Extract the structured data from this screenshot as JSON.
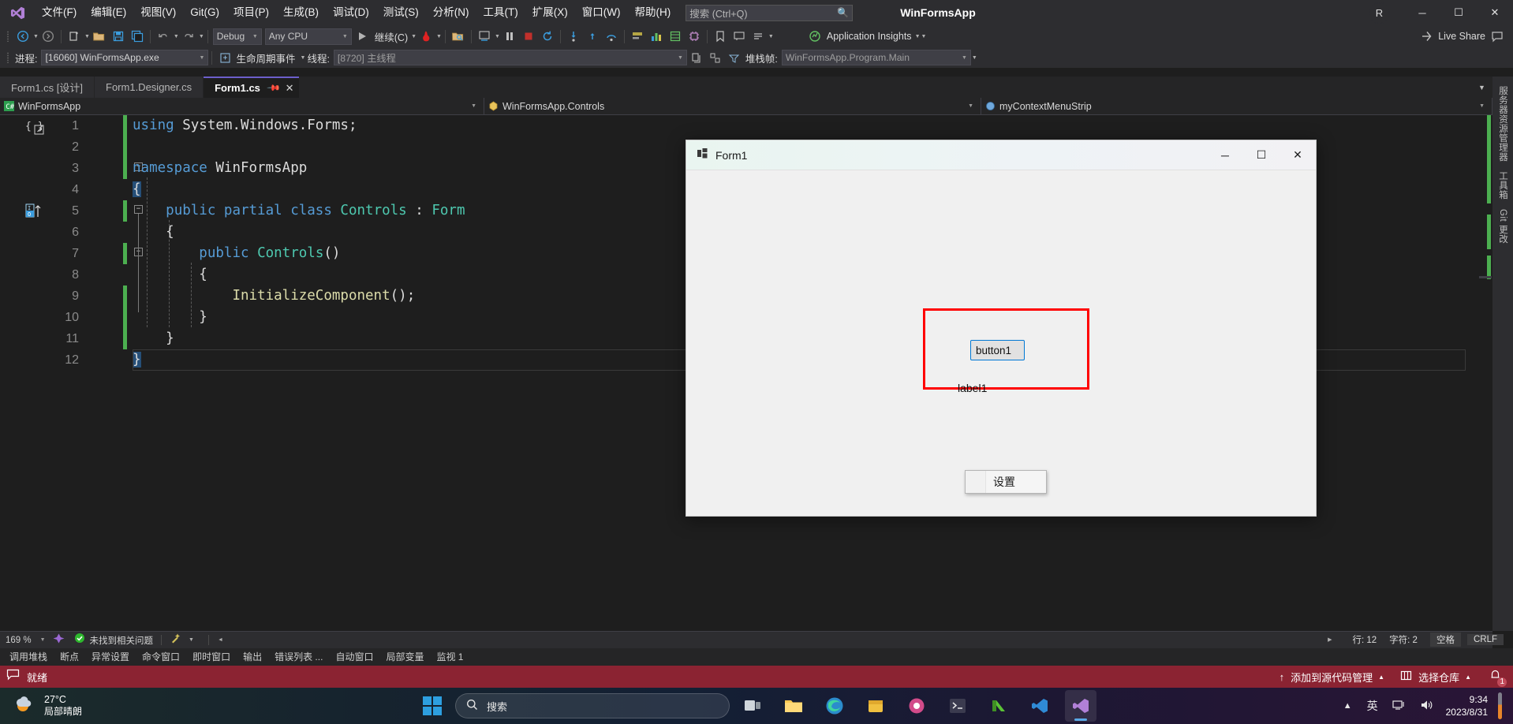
{
  "window": {
    "app_title": "WinFormsApp",
    "account_initial": "R",
    "minimize": "─",
    "maximize": "☐",
    "close": "✕",
    "live_share": "Live Share"
  },
  "menu": {
    "items": [
      "文件(F)",
      "编辑(E)",
      "视图(V)",
      "Git(G)",
      "项目(P)",
      "生成(B)",
      "调试(D)",
      "测试(S)",
      "分析(N)",
      "工具(T)",
      "扩展(X)",
      "窗口(W)",
      "帮助(H)"
    ],
    "search_placeholder": "搜索 (Ctrl+Q)"
  },
  "toolbar": {
    "config": "Debug",
    "platform": "Any CPU",
    "run_label": "继续(C)",
    "insights": "Application Insights"
  },
  "debug_toolbar": {
    "process_label": "进程:",
    "process_value": "[16060] WinFormsApp.exe",
    "lifecycle_label": "生命周期事件",
    "thread_label": "线程:",
    "thread_value": "[8720] 主线程",
    "stackframe_label": "堆栈帧:",
    "stackframe_value": "WinFormsApp.Program.Main"
  },
  "tabs": [
    {
      "label": "Form1.cs [设计]",
      "active": false
    },
    {
      "label": "Form1.Designer.cs",
      "active": false
    },
    {
      "label": "Form1.cs",
      "active": true
    }
  ],
  "navbar": {
    "project": "WinFormsApp",
    "type": "WinFormsApp.Controls",
    "member": "myContextMenuStrip"
  },
  "code": {
    "lines": [
      {
        "num": "1",
        "text": "using System.Windows.Forms;"
      },
      {
        "num": "2",
        "text": ""
      },
      {
        "num": "3",
        "text": "namespace WinFormsApp"
      },
      {
        "num": "4",
        "text": "{"
      },
      {
        "num": "5",
        "text": "    public partial class Controls : Form"
      },
      {
        "num": "6",
        "text": "    {"
      },
      {
        "num": "7",
        "text": "        public Controls()"
      },
      {
        "num": "8",
        "text": "        {"
      },
      {
        "num": "9",
        "text": "            InitializeComponent();"
      },
      {
        "num": "10",
        "text": "        }"
      },
      {
        "num": "11",
        "text": "    }"
      },
      {
        "num": "12",
        "text": "}"
      }
    ]
  },
  "right_rail": {
    "items": [
      "服务器资源管理器",
      "工具箱",
      "Git 更改"
    ]
  },
  "form1": {
    "title": "Form1",
    "minimize": "─",
    "maximize": "☐",
    "close": "✕",
    "button1_text": "button1",
    "context_menu_item": "设置",
    "label1_text": "label1"
  },
  "editor_status": {
    "zoom": "169 %",
    "issues": "未找到相关问题",
    "line": "行: 12",
    "char": "字符: 2",
    "indent": "空格",
    "eol": "CRLF"
  },
  "dock_tabs": [
    "调用堆栈",
    "断点",
    "异常设置",
    "命令窗口",
    "即时窗口",
    "输出",
    "错误列表 ...",
    "自动窗口",
    "局部变量",
    "监视 1"
  ],
  "vs_status": {
    "ready": "就绪",
    "source_control": "添加到源代码管理",
    "repo": "选择仓库",
    "notification_count": "1"
  },
  "taskbar": {
    "weather_temp": "27°C",
    "weather_desc": "局部晴朗",
    "search_placeholder": "搜索",
    "ime": "英",
    "time": "9:34",
    "date": "2023/8/31"
  },
  "colors": {
    "accent": "#6c5fcb",
    "status_bar": "#8b2332",
    "panel_border": "#ff0000",
    "change_bar": "#4caf50"
  }
}
